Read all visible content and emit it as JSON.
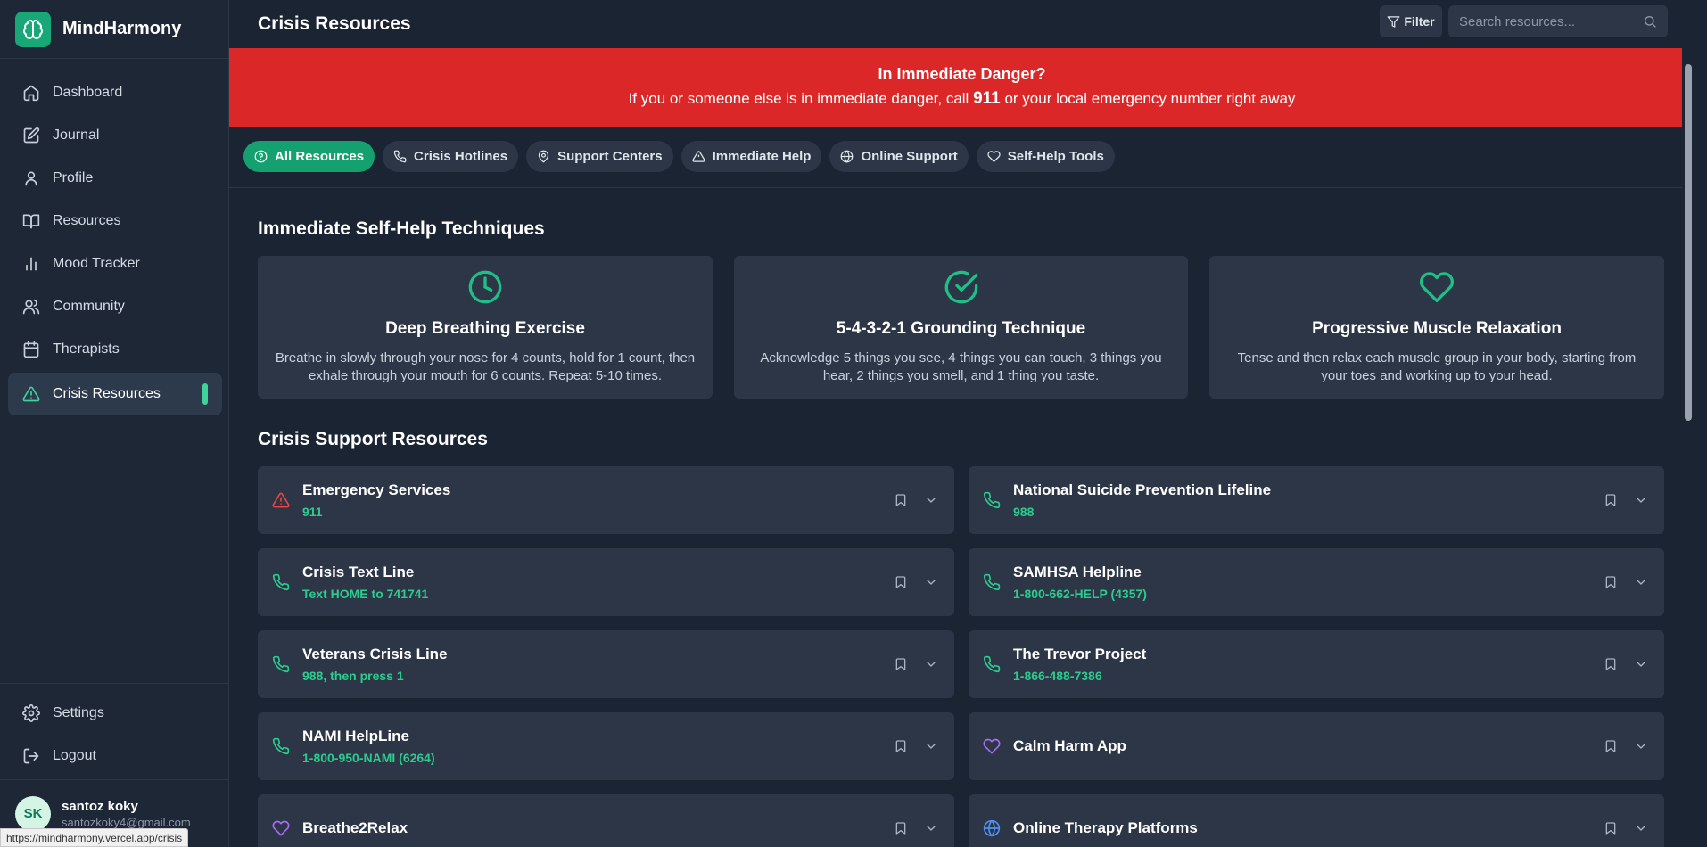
{
  "brand": {
    "name": "MindHarmony"
  },
  "sidebar": {
    "items": [
      {
        "label": "Dashboard",
        "icon": "home-icon"
      },
      {
        "label": "Journal",
        "icon": "edit-icon"
      },
      {
        "label": "Profile",
        "icon": "user-icon"
      },
      {
        "label": "Resources",
        "icon": "book-icon"
      },
      {
        "label": "Mood Tracker",
        "icon": "bar-chart-icon"
      },
      {
        "label": "Community",
        "icon": "users-icon"
      },
      {
        "label": "Therapists",
        "icon": "calendar-icon"
      },
      {
        "label": "Crisis Resources",
        "icon": "alert-triangle-icon",
        "active": true
      }
    ],
    "bottom": [
      {
        "label": "Settings",
        "icon": "gear-icon"
      },
      {
        "label": "Logout",
        "icon": "logout-icon"
      }
    ]
  },
  "user": {
    "initials": "SK",
    "name": "santoz koky",
    "email": "santozkoky4@gmail.com"
  },
  "status_url": "https://mindharmony.vercel.app/crisis",
  "header": {
    "title": "Crisis Resources",
    "filter_label": "Filter",
    "search_placeholder": "Search resources..."
  },
  "danger": {
    "title": "In Immediate Danger?",
    "text_before": "If you or someone else is in immediate danger, call ",
    "number": "911",
    "text_after": " or your local emergency number right away"
  },
  "filters": [
    {
      "label": "All Resources",
      "icon": "help-circle-icon",
      "active": true
    },
    {
      "label": "Crisis Hotlines",
      "icon": "phone-icon"
    },
    {
      "label": "Support Centers",
      "icon": "map-pin-icon"
    },
    {
      "label": "Immediate Help",
      "icon": "alert-triangle-icon"
    },
    {
      "label": "Online Support",
      "icon": "globe-icon"
    },
    {
      "label": "Self-Help Tools",
      "icon": "heart-icon"
    }
  ],
  "techniques": {
    "title": "Immediate Self-Help Techniques",
    "items": [
      {
        "title": "Deep Breathing Exercise",
        "icon": "clock-icon",
        "desc": "Breathe in slowly through your nose for 4 counts, hold for 1 count, then exhale through your mouth for 6 counts. Repeat 5-10 times."
      },
      {
        "title": "5-4-3-2-1 Grounding Technique",
        "icon": "check-circle-icon",
        "desc": "Acknowledge 5 things you see, 4 things you can touch, 3 things you hear, 2 things you smell, and 1 thing you taste."
      },
      {
        "title": "Progressive Muscle Relaxation",
        "icon": "heart-icon",
        "desc": "Tense and then relax each muscle group in your body, starting from your toes and working up to your head."
      }
    ]
  },
  "resources": {
    "title": "Crisis Support Resources",
    "items": [
      {
        "name": "Emergency Services",
        "detail": "911",
        "icon": "alert-triangle-icon",
        "color": "#ef4444"
      },
      {
        "name": "National Suicide Prevention Lifeline",
        "detail": "988",
        "icon": "phone-icon",
        "color": "#2ecb8f"
      },
      {
        "name": "Crisis Text Line",
        "detail": "Text HOME to 741741",
        "icon": "phone-icon",
        "color": "#2ecb8f"
      },
      {
        "name": "SAMHSA Helpline",
        "detail": "1-800-662-HELP (4357)",
        "icon": "phone-icon",
        "color": "#2ecb8f"
      },
      {
        "name": "Veterans Crisis Line",
        "detail": "988, then press 1",
        "icon": "phone-icon",
        "color": "#2ecb8f"
      },
      {
        "name": "The Trevor Project",
        "detail": "1-866-488-7386",
        "icon": "phone-icon",
        "color": "#2ecb8f"
      },
      {
        "name": "NAMI HelpLine",
        "detail": "1-800-950-NAMI (6264)",
        "icon": "phone-icon",
        "color": "#2ecb8f"
      },
      {
        "name": "Calm Harm App",
        "detail": "",
        "icon": "heart-icon",
        "color": "#a66cf0"
      },
      {
        "name": "Breathe2Relax",
        "detail": "",
        "icon": "heart-icon",
        "color": "#a66cf0"
      },
      {
        "name": "Online Therapy Platforms",
        "detail": "",
        "icon": "globe-icon",
        "color": "#4f8ff0"
      }
    ]
  },
  "colors": {
    "accent": "#1fbf87",
    "danger": "#db2727",
    "background": "#1b2433",
    "card": "#2c3646"
  }
}
